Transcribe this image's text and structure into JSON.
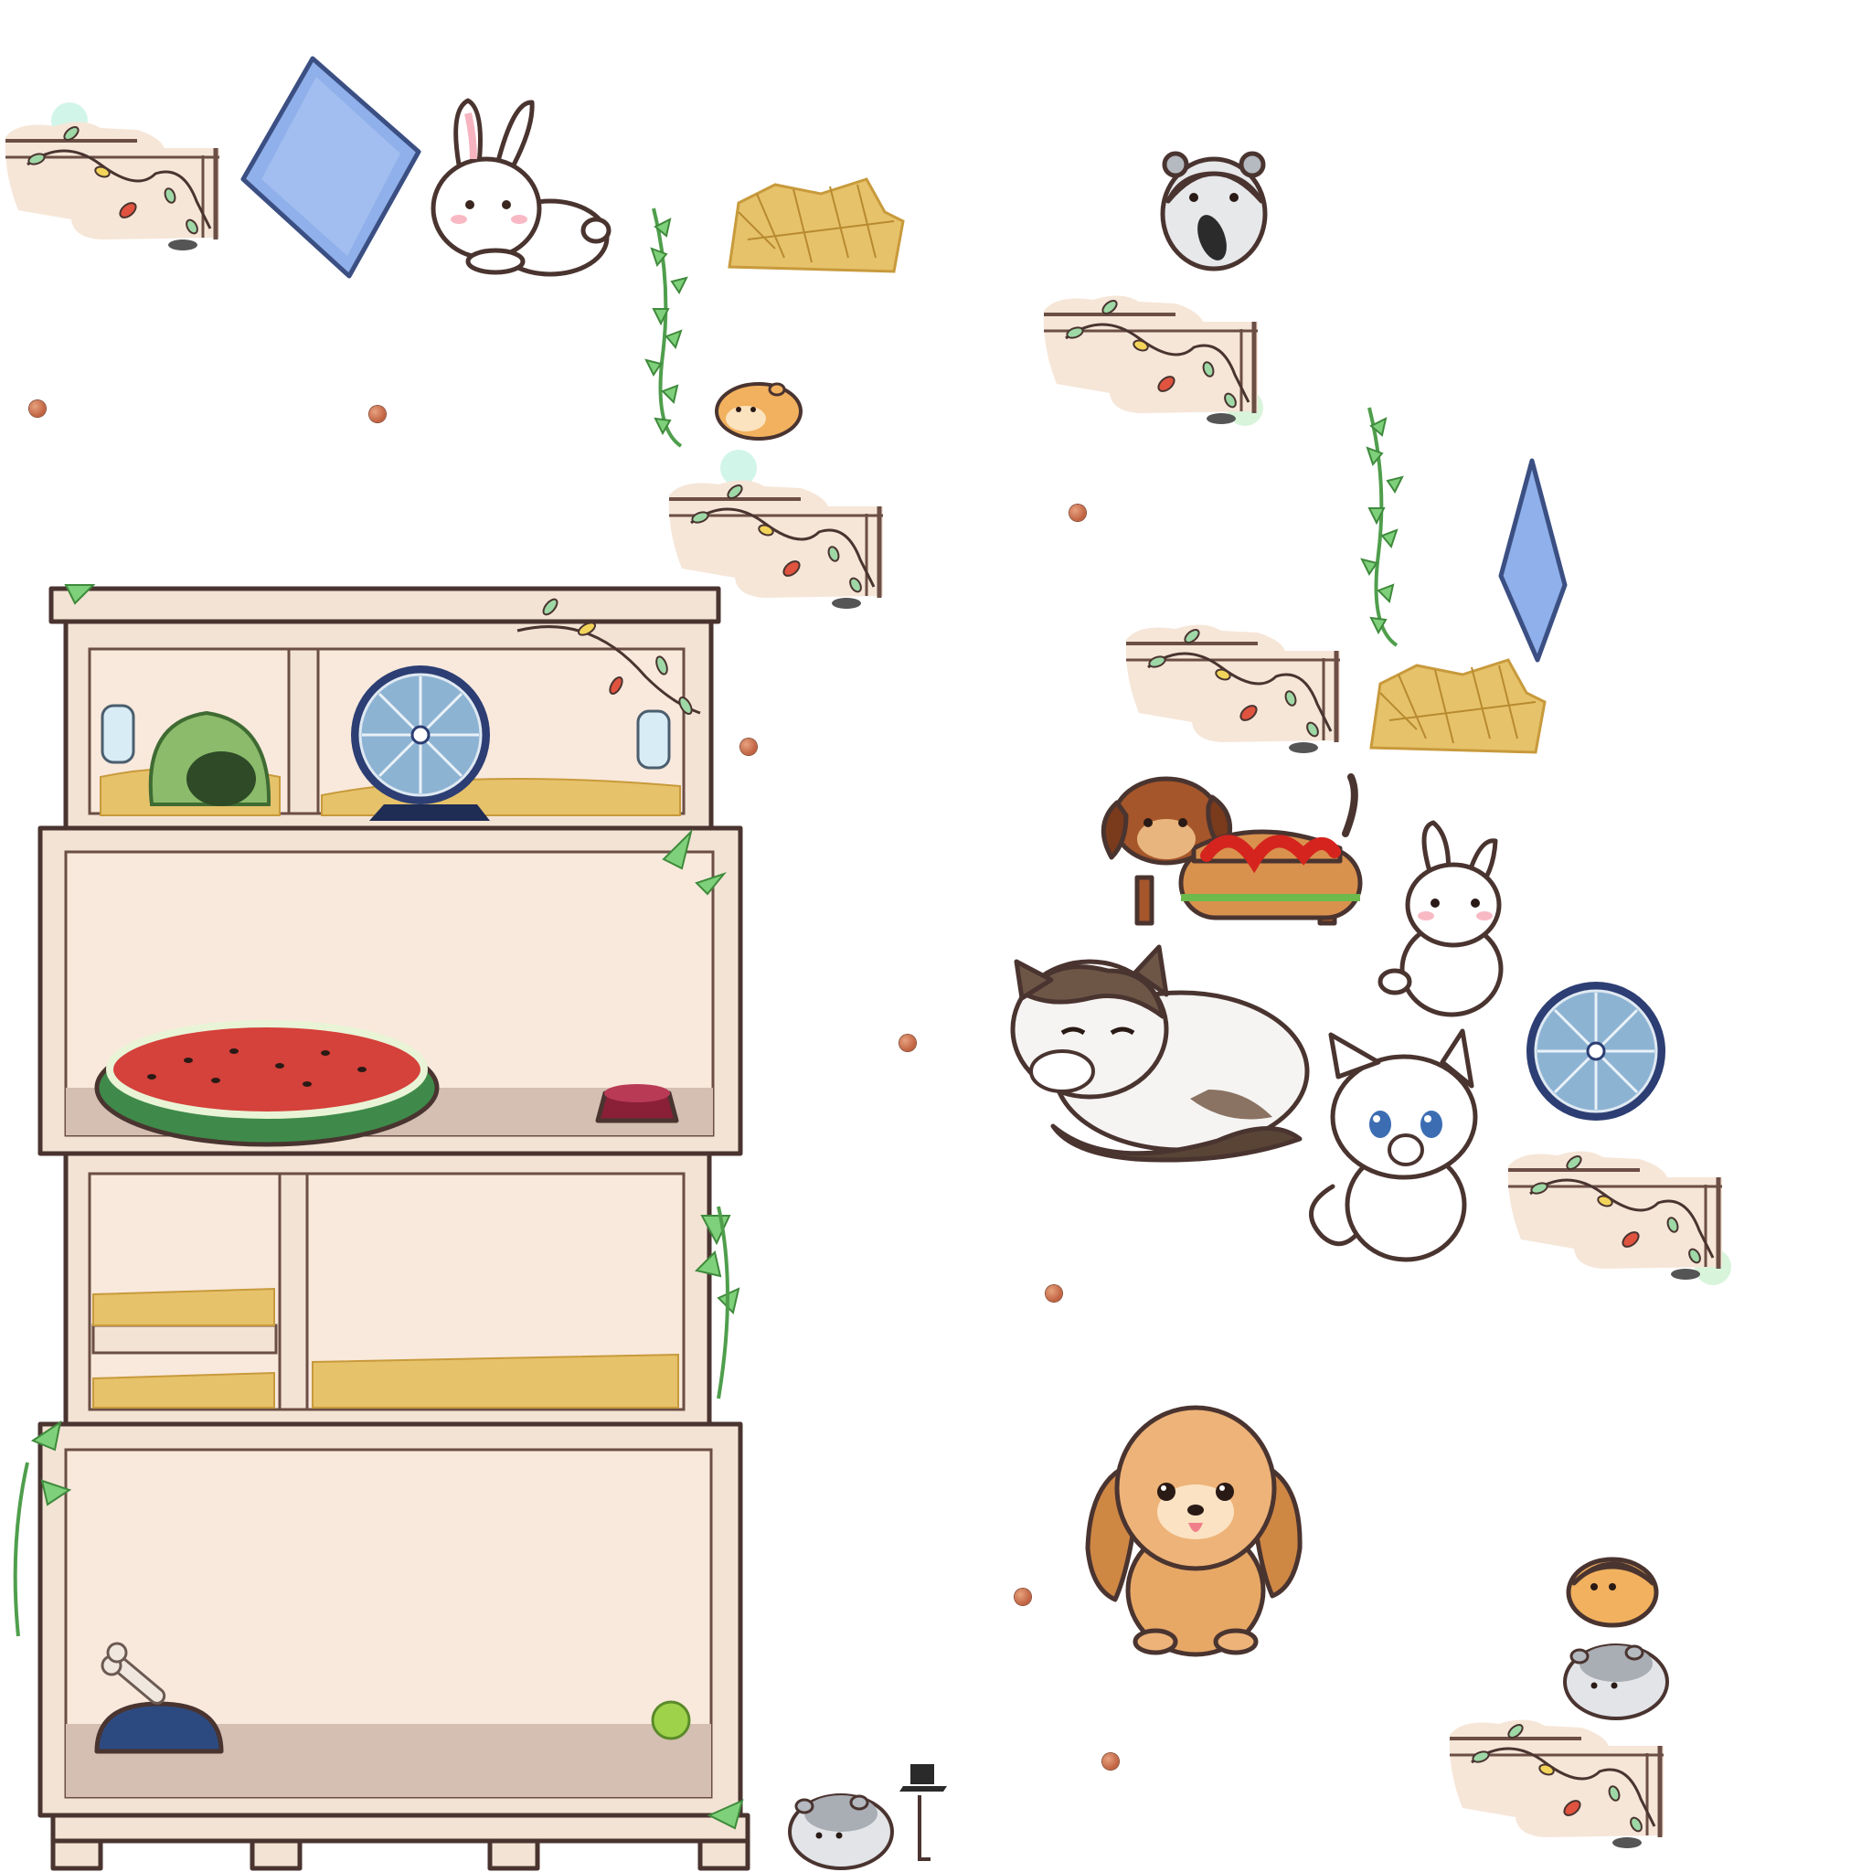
{
  "scene": {
    "type": "sprite-sheet",
    "background": "#ffffff"
  },
  "palette": {
    "cabinet_wood": "#f3e3d4",
    "cabinet_inner": "#f9e9dc",
    "cabinet_floor": "#d5bfb2",
    "outline": "#4a3430",
    "hay": "#e6c26a",
    "vine_green": "#6bc26a",
    "wheel_blue": "#7fa7c9",
    "watermelon_red": "#d5413b",
    "watermelon_rind": "#3f8a4a",
    "pellet": "#c0603f",
    "cushion_blue": "#8fb0ea"
  },
  "sprites": [
    {
      "id": "string-lights-shelf",
      "count": 6
    },
    {
      "id": "blue-cushion",
      "count": 2
    },
    {
      "id": "white-bunny",
      "count": 2
    },
    {
      "id": "hay-pile",
      "count": 2
    },
    {
      "id": "hanging-vine",
      "count": 2
    },
    {
      "id": "orange-hamster",
      "count": 2
    },
    {
      "id": "grey-hamster",
      "count": 3
    },
    {
      "id": "pellet",
      "count": 9
    },
    {
      "id": "hamster-cabinet",
      "count": 1
    },
    {
      "id": "exercise-wheel",
      "count": 2
    },
    {
      "id": "hotdog-dachshund",
      "count": 1
    },
    {
      "id": "fluffy-calico-cat",
      "count": 1
    },
    {
      "id": "white-kitten",
      "count": 1
    },
    {
      "id": "golden-puppy",
      "count": 1
    },
    {
      "id": "grey-hamster-with-laptop",
      "count": 1
    }
  ],
  "cabinet_items": {
    "top_tier": [
      "water-bottle",
      "green-hideout",
      "exercise-wheel",
      "water-bottle",
      "hay-bedding"
    ],
    "second_tier": [
      "watermelon-bed",
      "red-food-bowl"
    ],
    "third_tier": [
      "hay-shelf",
      "hay-bedding"
    ],
    "bottom_tier": [
      "bone-bowl",
      "tennis-ball"
    ]
  }
}
